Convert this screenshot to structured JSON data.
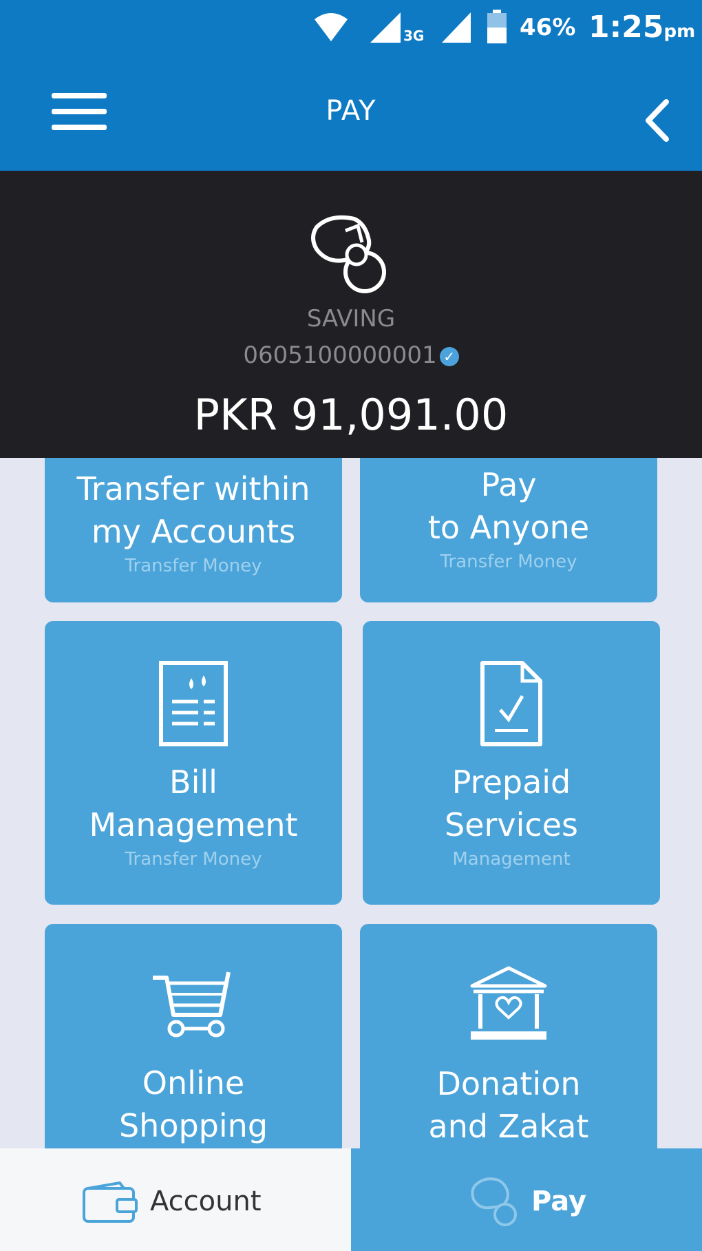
{
  "status_bar": {
    "network": "3G",
    "battery": "46%",
    "time": "1:25",
    "ampm": "pm"
  },
  "header": {
    "title": "PAY"
  },
  "account": {
    "type": "SAVING",
    "number": "0605100000001",
    "currency": "PKR",
    "balance": "91,091.00"
  },
  "tiles": [
    {
      "title_line1": "Transfer within",
      "title_line2": "my Accounts",
      "sub": "Transfer Money"
    },
    {
      "title_line1": "Pay",
      "title_line2": "to Anyone",
      "sub": "Transfer Money"
    },
    {
      "title_line1": "Bill",
      "title_line2": "Management",
      "sub": "Transfer Money",
      "icon": "bill-icon"
    },
    {
      "title_line1": "Prepaid",
      "title_line2": "Services",
      "sub": "Management",
      "icon": "prepaid-document-icon"
    },
    {
      "title_line1": "Online",
      "title_line2": "Shopping",
      "icon": "shopping-cart-icon"
    },
    {
      "title_line1": "Donation",
      "title_line2": "and Zakat",
      "icon": "donation-building-icon"
    }
  ],
  "bottom_nav": {
    "account_label": "Account",
    "pay_label": "Pay"
  },
  "colors": {
    "primary": "#0f7ac4",
    "tile": "#4aa4d9",
    "panel": "#202024",
    "background": "#e4e7f1"
  }
}
